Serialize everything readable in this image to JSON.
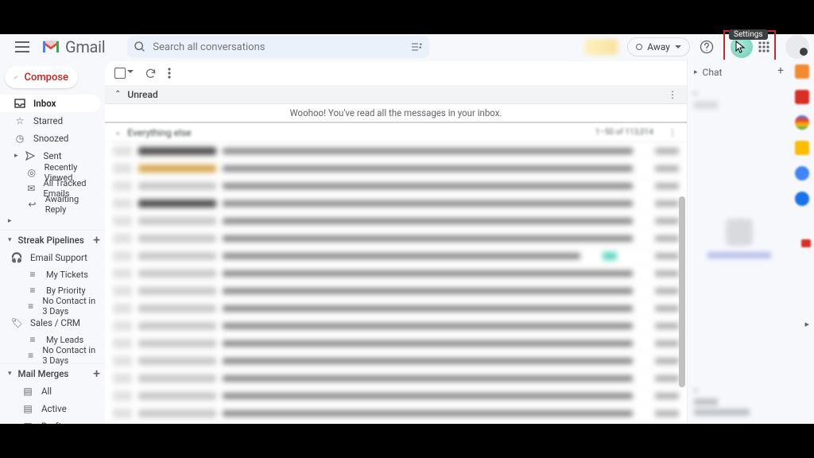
{
  "header": {
    "brand": "Gmail",
    "search_placeholder": "Search all conversations",
    "status_label": "Away",
    "settings_tooltip": "Settings"
  },
  "compose_label": "Compose",
  "nav": {
    "inbox": "Inbox",
    "starred": "Starred",
    "snoozed": "Snoozed",
    "sent": "Sent",
    "recently_viewed": "Recently Viewed",
    "all_tracked": "All Tracked Emails",
    "awaiting_reply": "Awaiting Reply"
  },
  "sections": {
    "streak_pipelines": "Streak Pipelines",
    "mail_merges": "Mail Merges"
  },
  "pipelines": {
    "email_support": "Email Support",
    "my_tickets": "My Tickets",
    "by_priority": "By Priority",
    "no_contact_1": "No Contact in 3 Days",
    "sales_crm": "Sales / CRM",
    "my_leads": "My Leads",
    "no_contact_2": "No Contact in 3 Days"
  },
  "merges": {
    "all": "All",
    "active": "Active",
    "draft": "Draft"
  },
  "mail": {
    "unread_label": "Unread",
    "empty_unread": "Woohoo! You've read all the messages in your inbox.",
    "everything_else": "Everything else",
    "count_text": "1–50 of 113,014"
  },
  "chat": {
    "header": "Chat"
  }
}
